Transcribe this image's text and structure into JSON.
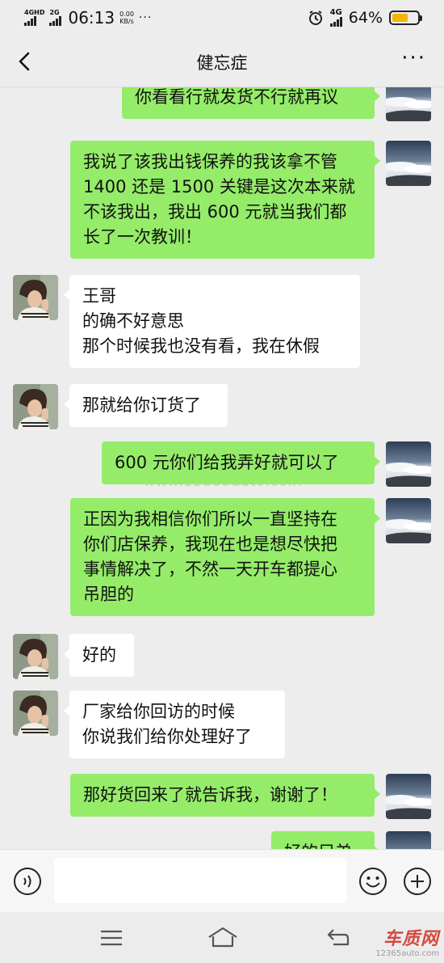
{
  "status_bar": {
    "signal_1_label": "4GHD",
    "signal_2_label": "2G",
    "time": "06:13",
    "speed_value": "0.00",
    "speed_unit": "KB/s",
    "more_dots": "···",
    "network_label": "4G",
    "battery_percent": "64%",
    "battery_level": 0.64,
    "battery_color": "#f5b300"
  },
  "header": {
    "title": "健忘症",
    "back_icon": "chevron-left-icon",
    "more_icon": "more-dots-icon",
    "more_label": "···"
  },
  "messages": [
    {
      "side": "out",
      "lines": [
        "你看看行就发货不行就再议"
      ]
    },
    {
      "side": "out",
      "lines": [
        "我说了该我出钱保养的我该拿不管",
        "1400 还是 1500 关键是这次本来就",
        "不该我出，我出 600 元就当我们都",
        "长了一次教训！"
      ]
    },
    {
      "side": "in",
      "lines": [
        "王哥",
        "的确不好意思",
        "那个时候我也没有看，我在休假"
      ]
    },
    {
      "side": "in",
      "lines": [
        "那就给你订货了"
      ]
    },
    {
      "side": "out",
      "lines": [
        "600 元你们给我弄好就可以了"
      ]
    },
    {
      "side": "out",
      "lines": [
        "正因为我相信你们所以一直坚持在",
        "你们店保养，我现在也是想尽快把",
        "事情解决了，不然一天开车都提心",
        "吊胆的"
      ]
    },
    {
      "side": "in",
      "lines": [
        "好的"
      ]
    },
    {
      "side": "in",
      "lines": [
        "厂家给你回访的时候",
        "你说我们给你处理好了"
      ]
    },
    {
      "side": "out",
      "lines": [
        "那好货回来了就告诉我，谢谢了！"
      ]
    },
    {
      "side": "out",
      "lines": [
        "好的兄弟"
      ]
    }
  ],
  "watermark": "www.12365auto.com",
  "input_bar": {
    "voice_icon": "voice-icon",
    "input_value": "",
    "emoji_icon": "emoji-icon",
    "plus_icon": "plus-icon"
  },
  "nav_bar": {
    "menu_icon": "menu-icon",
    "home_icon": "home-icon",
    "back_icon": "back-icon"
  },
  "logo": {
    "name": "车质网",
    "site": "12365auto.com"
  },
  "colors": {
    "outgoing_bubble": "#95ec69",
    "incoming_bubble": "#ffffff",
    "background": "#ededed"
  }
}
